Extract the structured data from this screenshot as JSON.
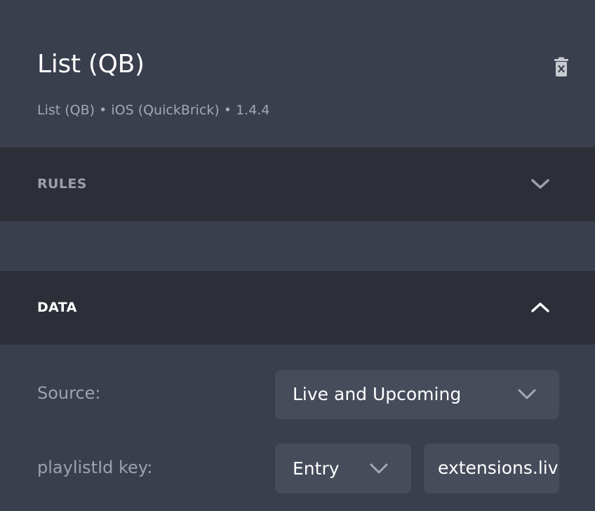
{
  "header": {
    "title": "List (QB)",
    "subtitle": "List (QB) • iOS (QuickBrick) • 1.4.4",
    "delete_icon": "trash-icon"
  },
  "sections": {
    "rules": {
      "label": "RULES",
      "icon": "chevron-down-icon",
      "expanded": false
    },
    "data": {
      "label": "DATA",
      "icon": "chevron-up-icon",
      "expanded": true
    }
  },
  "data_fields": {
    "source": {
      "label": "Source:",
      "value": "Live and Upcoming"
    },
    "playlist_key": {
      "label": "playlistId key:",
      "type_value": "Entry",
      "text_value": "extensions.liv"
    }
  },
  "colors": {
    "background": "#3a3f4e",
    "section_bar": "#2c2f38",
    "input_bg": "#474c5b",
    "muted_text": "#9ea2ad"
  }
}
